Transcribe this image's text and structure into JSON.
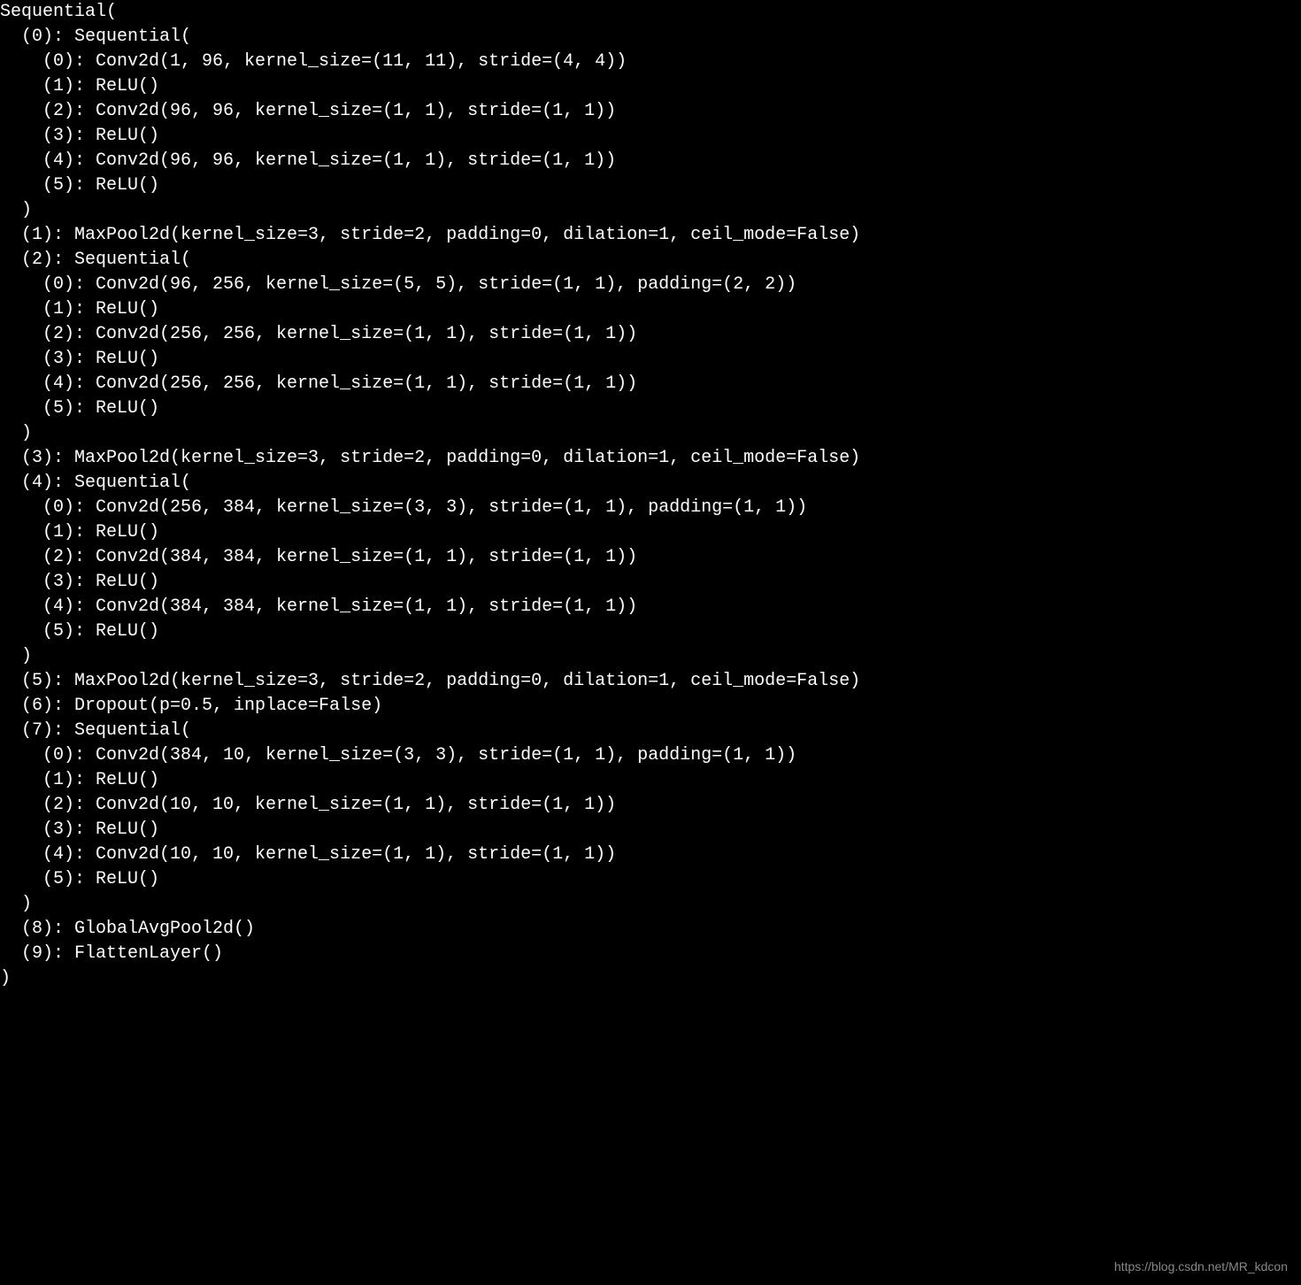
{
  "lines": [
    "Sequential(",
    "  (0): Sequential(",
    "    (0): Conv2d(1, 96, kernel_size=(11, 11), stride=(4, 4))",
    "    (1): ReLU()",
    "    (2): Conv2d(96, 96, kernel_size=(1, 1), stride=(1, 1))",
    "    (3): ReLU()",
    "    (4): Conv2d(96, 96, kernel_size=(1, 1), stride=(1, 1))",
    "    (5): ReLU()",
    "  )",
    "  (1): MaxPool2d(kernel_size=3, stride=2, padding=0, dilation=1, ceil_mode=False)",
    "  (2): Sequential(",
    "    (0): Conv2d(96, 256, kernel_size=(5, 5), stride=(1, 1), padding=(2, 2))",
    "    (1): ReLU()",
    "    (2): Conv2d(256, 256, kernel_size=(1, 1), stride=(1, 1))",
    "    (3): ReLU()",
    "    (4): Conv2d(256, 256, kernel_size=(1, 1), stride=(1, 1))",
    "    (5): ReLU()",
    "  )",
    "  (3): MaxPool2d(kernel_size=3, stride=2, padding=0, dilation=1, ceil_mode=False)",
    "  (4): Sequential(",
    "    (0): Conv2d(256, 384, kernel_size=(3, 3), stride=(1, 1), padding=(1, 1))",
    "    (1): ReLU()",
    "    (2): Conv2d(384, 384, kernel_size=(1, 1), stride=(1, 1))",
    "    (3): ReLU()",
    "    (4): Conv2d(384, 384, kernel_size=(1, 1), stride=(1, 1))",
    "    (5): ReLU()",
    "  )",
    "  (5): MaxPool2d(kernel_size=3, stride=2, padding=0, dilation=1, ceil_mode=False)",
    "  (6): Dropout(p=0.5, inplace=False)",
    "  (7): Sequential(",
    "    (0): Conv2d(384, 10, kernel_size=(3, 3), stride=(1, 1), padding=(1, 1))",
    "    (1): ReLU()",
    "    (2): Conv2d(10, 10, kernel_size=(1, 1), stride=(1, 1))",
    "    (3): ReLU()",
    "    (4): Conv2d(10, 10, kernel_size=(1, 1), stride=(1, 1))",
    "    (5): ReLU()",
    "  )",
    "  (8): GlobalAvgPool2d()",
    "  (9): FlattenLayer()",
    ")"
  ],
  "watermark": "https://blog.csdn.net/MR_kdcon"
}
